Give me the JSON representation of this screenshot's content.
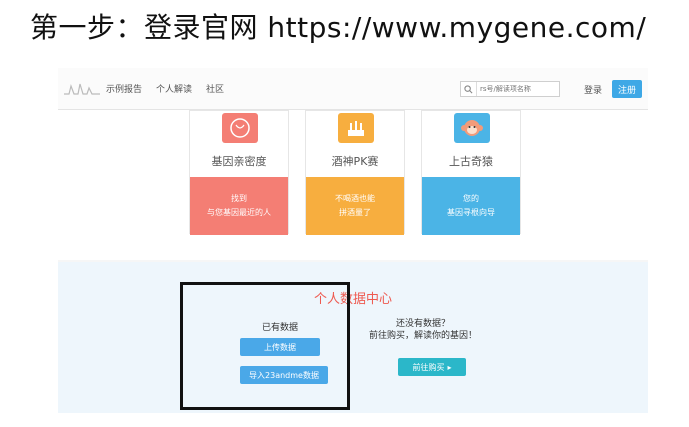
{
  "heading": "第一步：登录官网 https://www.mygene.com/",
  "nav": {
    "links": [
      "示例报告",
      "个人解读",
      "社区"
    ],
    "search_placeholder": "rs号/解读项名称",
    "login": "登录",
    "register": "注册"
  },
  "cards": [
    {
      "title": "基因亲密度",
      "line1": "找到",
      "line2": "与您基因最近的人",
      "color": "#f47e74",
      "icon": "heart-icon"
    },
    {
      "title": "酒神PK赛",
      "line1": "不喝酒也能",
      "line2": "拼酒量了",
      "color": "#f7ae3f",
      "icon": "trophy-icon"
    },
    {
      "title": "上古奇猿",
      "line1": "您的",
      "line2": "基因寻根向导",
      "color": "#4bb4e6",
      "icon": "monkey-icon"
    }
  ],
  "datacenter": {
    "title": "个人数据中心",
    "have_data": "已有数据",
    "upload": "上传数据",
    "import": "导入23andme数据",
    "no_data_line1": "还没有数据？",
    "no_data_line2": "前往购买，解读你的基因！",
    "buy": "前往购买"
  }
}
